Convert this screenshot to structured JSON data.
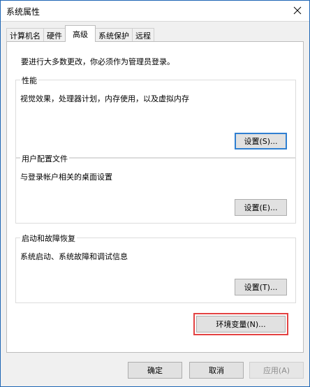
{
  "window": {
    "title": "系统属性"
  },
  "tabs": [
    {
      "label": "计算机名"
    },
    {
      "label": "硬件"
    },
    {
      "label": "高级"
    },
    {
      "label": "系统保护"
    },
    {
      "label": "远程"
    }
  ],
  "active_tab": "高级",
  "panel": {
    "admin_note": "要进行大多数更改，你必须作为管理员登录。"
  },
  "groups": {
    "performance": {
      "title": "性能",
      "description": "视觉效果，处理器计划，内存使用，以及虚拟内存",
      "button_label": "设置(S)..."
    },
    "user_profiles": {
      "title": "用户配置文件",
      "description": "与登录帐户相关的桌面设置",
      "button_label": "设置(E)..."
    },
    "startup_recovery": {
      "title": "启动和故障恢复",
      "description": "系统启动、系统故障和调试信息",
      "button_label": "设置(T)..."
    }
  },
  "env_vars_button": {
    "label": "环境变量(N)..."
  },
  "footer": {
    "ok": "确定",
    "cancel": "取消",
    "apply": "应用(A)"
  },
  "colors": {
    "window_border": "#1e66b5",
    "focus_ring": "#2f7fd1",
    "highlight_box": "#e34242",
    "panel_bg": "#ffffff",
    "window_bg": "#f0f0f0"
  },
  "icons": {
    "close": "close-icon"
  }
}
